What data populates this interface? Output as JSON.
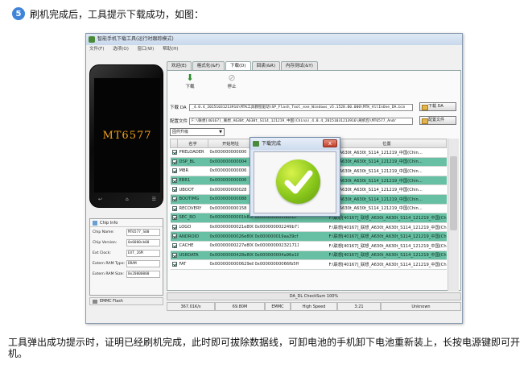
{
  "step": {
    "number": "5",
    "title": "刷机完成后，工具提示下载成功，如图："
  },
  "window": {
    "title": "智能手机下载工具(运行时跟踪模式)",
    "menu": [
      "文件(F)",
      "选项(O)",
      "窗口(W)",
      "帮助(H)"
    ]
  },
  "phone": {
    "model": "MT6577"
  },
  "chip_info": {
    "title": "Chip Info",
    "rows": [
      {
        "label": "Chip Name:",
        "value": "MT6577_S00"
      },
      {
        "label": "Chip Version:",
        "value": "0x0000cb00"
      },
      {
        "label": "Ext Clock:",
        "value": "EXT_26M"
      },
      {
        "label": "Extern RAM Type:",
        "value": "DRAM"
      },
      {
        "label": "Extern RAM Size:",
        "value": "0x20000000"
      }
    ],
    "emmc": "EMMC Flash"
  },
  "tabs": [
    "欢迎(E)",
    "格式化(&F)",
    "下载(D)",
    "回读(&R)",
    "内存测试(&Y)"
  ],
  "toolbar": {
    "download": "下载",
    "stop": "停止"
  },
  "fields": {
    "da_label": "下载 DA",
    "da_path": "_4.0.4_20151031213916\\MTK工具教程驱动\\SP_Flash_Tool_exe_Windows_v5.1528.00.000\\MTK_AllInOne_DA.bin",
    "da_button": "下载 DA",
    "scatter_label": "配置文件",
    "scatter_path": "F:\\联想[40167]_联想_A630t_A630t_S114_121219_中国(China)_4.0.4_20151031213916\\刷机包\\MT6577_Andr",
    "scatter_button": "配置文件",
    "mode": "固件升级"
  },
  "table": {
    "headers": [
      "",
      "名字",
      "开始地址",
      "",
      "",
      "位置"
    ],
    "rows": [
      {
        "name": "PRELOADER",
        "start": "0x000000000000",
        "end": "",
        "len": "",
        "loc": "联想_A630t_A630t_S114_121219_中国(Chin...",
        "hl": false
      },
      {
        "name": "DSP_BL",
        "start": "0x000000000004",
        "end": "",
        "len": "",
        "loc": "联想_A630t_A630t_S114_121219_中国(Chin...",
        "hl": true
      },
      {
        "name": "MBR",
        "start": "0x000000000006",
        "end": "",
        "len": "",
        "loc": "联想_A630t_A630t_S114_121219_中国(Chin...",
        "hl": false
      },
      {
        "name": "EBR1",
        "start": "0x000000000006",
        "end": "",
        "len": "",
        "loc": "联想_A630t_A630t_S114_121219_中国(Chin...",
        "hl": true
      },
      {
        "name": "UBOOT",
        "start": "0x000000000028",
        "end": "",
        "len": "",
        "loc": "联想_A630t_A630t_S114_121219_中国(Chin...",
        "hl": false
      },
      {
        "name": "BOOTIMG",
        "start": "0x000000000088",
        "end": "",
        "len": "",
        "loc": "联想_A630t_A630t_S114_121219_中国(Chin...",
        "hl": true
      },
      {
        "name": "RECOVERY",
        "start": "0x000000000158",
        "end": "",
        "len": "",
        "loc": "联想_A630t_A630t_S114_121219_中国(Chin...",
        "hl": false
      },
      {
        "name": "SEC_RO",
        "start": "0x00000000001b88000",
        "end": "0x000000001fa0fb7",
        "len": "",
        "loc": "F:\\联想[40167]_联想_A630t_A630t_S114_121219_中国(Chin...",
        "hl": true
      },
      {
        "name": "LOGO",
        "start": "0x00000000021e8000",
        "end": "0x000000002249b77",
        "len": "",
        "loc": "F:\\联想[40167]_联想_A630t_A630t_S114_121219_中国(Chin...",
        "hl": false
      },
      {
        "name": "ANDROID",
        "start": "0x00000000026e8000",
        "end": "0x000000019aa39cf",
        "len": "",
        "loc": "F:\\联想[40167]_联想_A630t_A630t_S114_121219_中国(Chin...",
        "hl": true
      },
      {
        "name": "CACHE",
        "start": "0x00000000227e8000",
        "end": "0x0000000023217117",
        "len": "",
        "loc": "F:\\联想[40167]_联想_A630t_A630t_S114_121219_中国(Chin...",
        "hl": false
      },
      {
        "name": "USRDATA",
        "start": "0x00000000428e8000",
        "end": "0x000000004a96e18f",
        "len": "",
        "loc": "F:\\联想[40167]_联想_A630t_A630t_S114_121219_中国(Chin...",
        "hl": true
      },
      {
        "name": "FAT",
        "start": "0x0000000000629e8000",
        "end": "0x00000000066fb5ff",
        "len": "",
        "loc": "F:\\联想[40167]_联想_A630t_A630t_S114_121219_中国(Chin...",
        "hl": false
      }
    ]
  },
  "progress_text": "DA_DL CheckSum 100%",
  "status": [
    "367.01K/s",
    "69.80M",
    "EMMC",
    "High Speed",
    "3:21",
    "Unknown"
  ],
  "dialog": {
    "title": "下载完成",
    "close": "x"
  },
  "caption": "工具弹出成功提示时，证明已经刷机完成，此时即可拔除数据线，可卸电池的手机卸下电池重新装上，长按电源键即可开机。"
}
